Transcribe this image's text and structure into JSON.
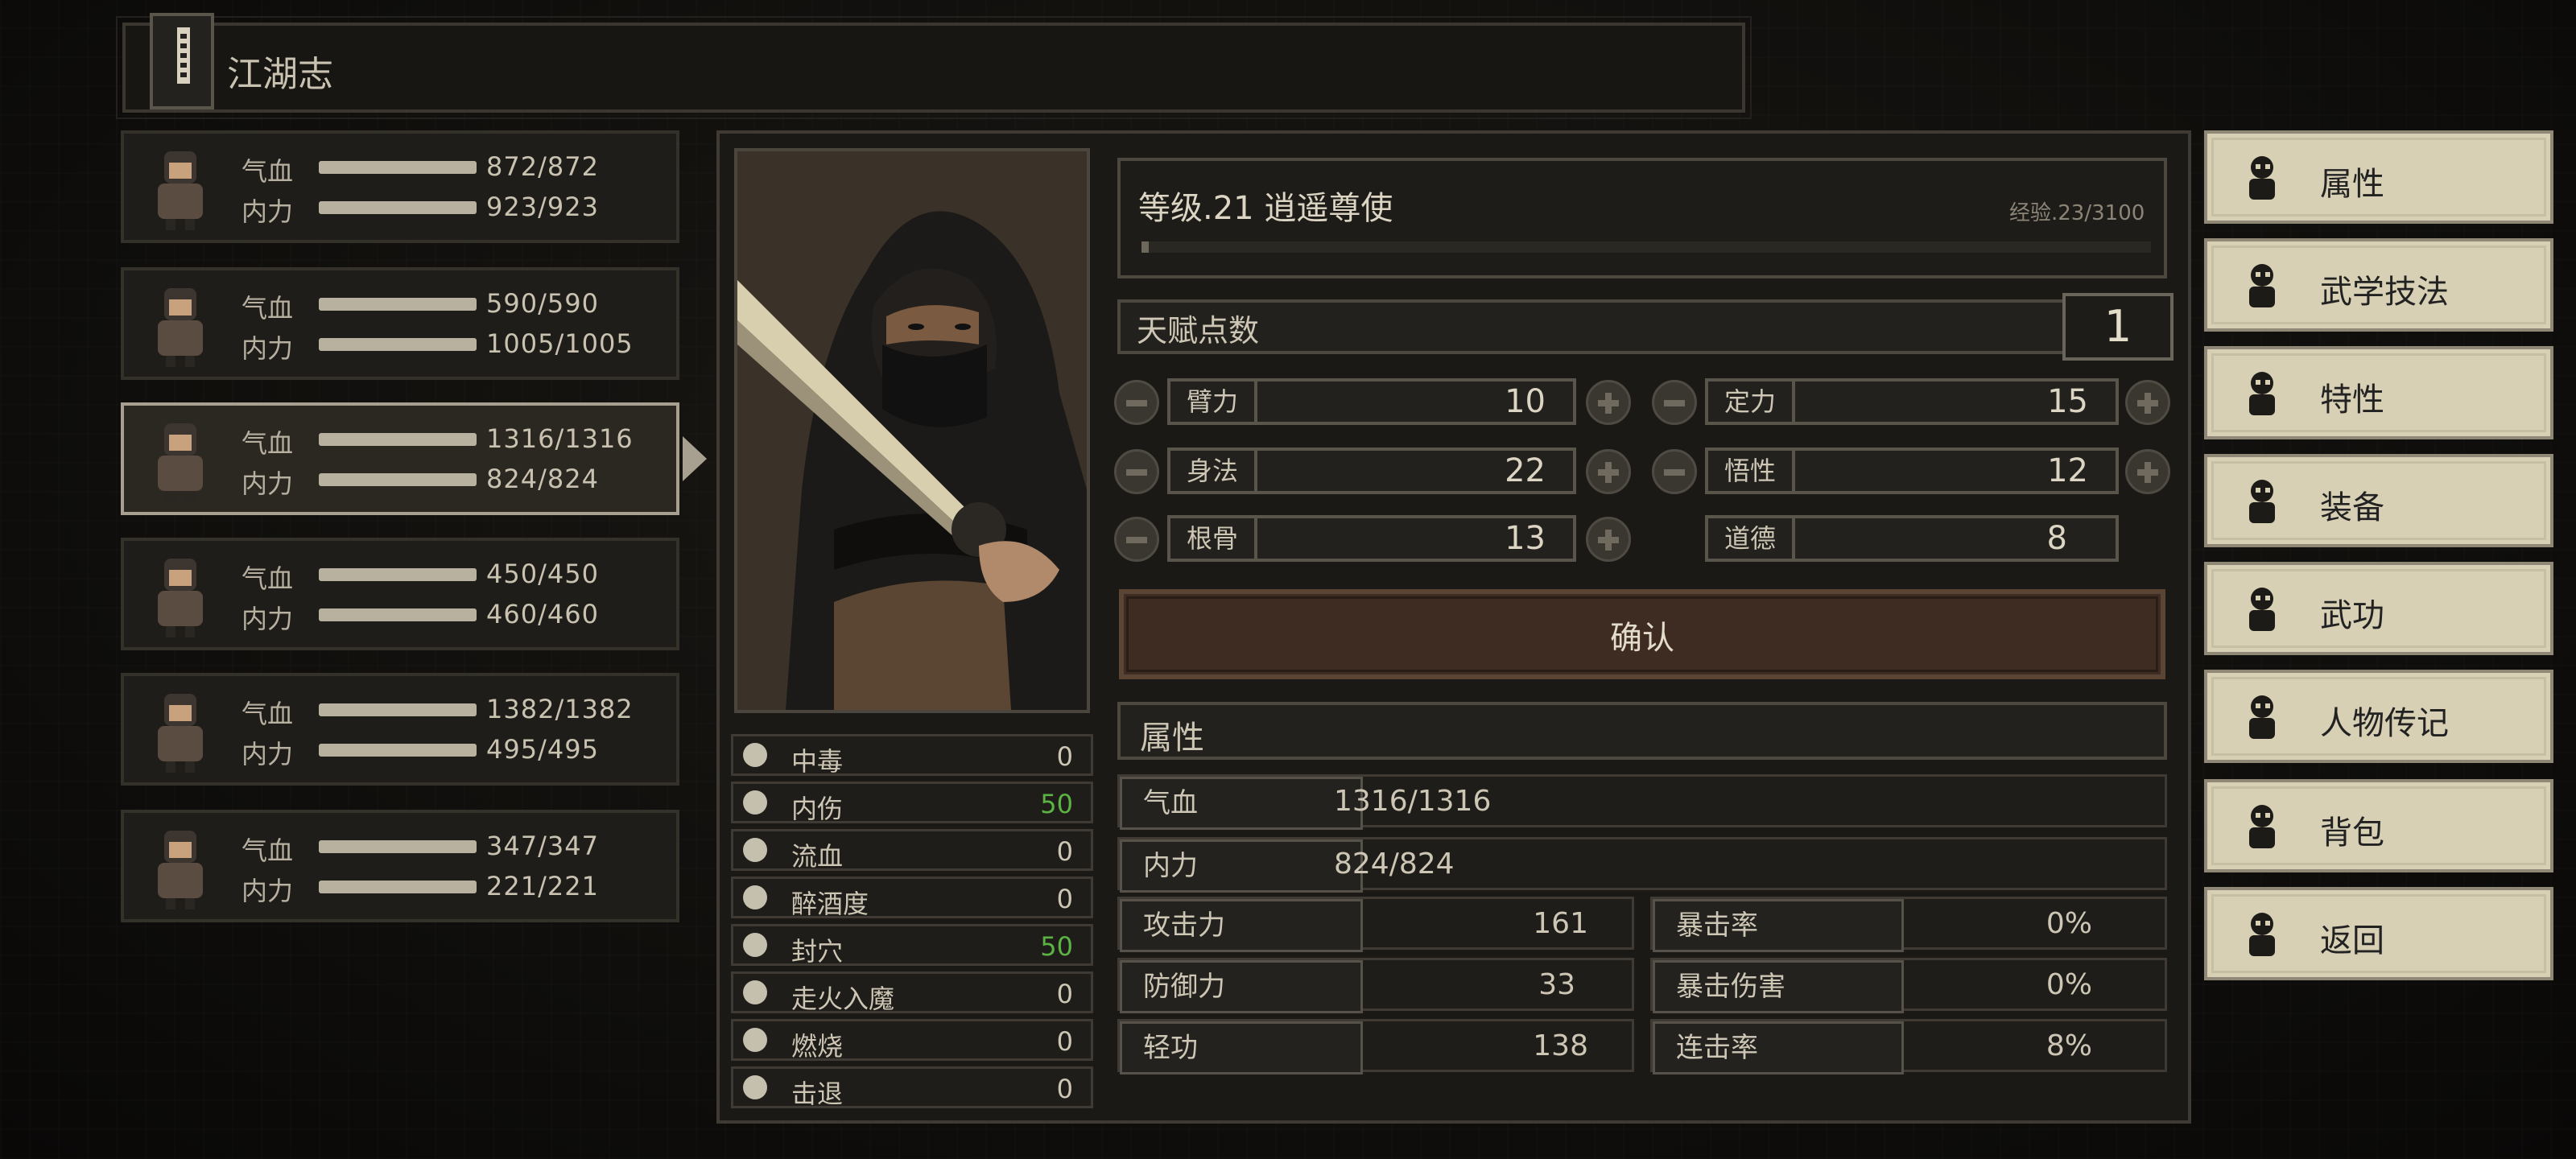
{
  "window": {
    "title": "江湖志"
  },
  "party": [
    {
      "hp_label": "气血",
      "hp": "872/872",
      "mp_label": "内力",
      "mp": "923/923",
      "avatar": "monk-icon"
    },
    {
      "hp_label": "气血",
      "hp": "590/590",
      "mp_label": "内力",
      "mp": "1005/1005",
      "avatar": "scholar-icon"
    },
    {
      "hp_label": "气血",
      "hp": "1316/1316",
      "mp_label": "内力",
      "mp": "824/824",
      "avatar": "assassin-icon"
    },
    {
      "hp_label": "气血",
      "hp": "450/450",
      "mp_label": "内力",
      "mp": "460/460",
      "avatar": "official-icon"
    },
    {
      "hp_label": "气血",
      "hp": "1382/1382",
      "mp_label": "内力",
      "mp": "495/495",
      "avatar": "straw-hat-icon"
    },
    {
      "hp_label": "气血",
      "hp": "347/347",
      "mp_label": "内力",
      "mp": "221/221",
      "avatar": "goose-icon"
    }
  ],
  "character": {
    "level_line": "等级.21  逍遥尊使",
    "exp_label": "经验.23/3100",
    "exp_fraction": 0.0074,
    "talent_label": "天赋点数",
    "talent_points": "1"
  },
  "attributes": [
    {
      "label": "臂力",
      "value": "10"
    },
    {
      "label": "定力",
      "value": "15"
    },
    {
      "label": "身法",
      "value": "22"
    },
    {
      "label": "悟性",
      "value": "12"
    },
    {
      "label": "根骨",
      "value": "13"
    },
    {
      "label": "道德",
      "value": "8"
    }
  ],
  "confirm_label": "确认",
  "properties": {
    "section_title": "属性",
    "hp": {
      "label": "气血",
      "value": "1316/1316"
    },
    "mp": {
      "label": "内力",
      "value": "824/824"
    },
    "attack": {
      "label": "攻击力",
      "value": "161"
    },
    "crit_rate": {
      "label": "暴击率",
      "value": "0%"
    },
    "defense": {
      "label": "防御力",
      "value": "33"
    },
    "crit_dmg": {
      "label": "暴击伤害",
      "value": "0%"
    },
    "agility": {
      "label": "轻功",
      "value": "138"
    },
    "combo": {
      "label": "连击率",
      "value": "8%"
    }
  },
  "statuses": [
    {
      "name": "中毒",
      "value": "0",
      "icon": "skull-icon"
    },
    {
      "name": "内伤",
      "value": "50",
      "icon": "broken-heart-icon"
    },
    {
      "name": "流血",
      "value": "0",
      "icon": "blood-icon"
    },
    {
      "name": "醉酒度",
      "value": "0",
      "icon": "drunk-icon"
    },
    {
      "name": "封穴",
      "value": "50",
      "icon": "seal-icon"
    },
    {
      "name": "走火入魔",
      "value": "0",
      "icon": "demon-icon"
    },
    {
      "name": "燃烧",
      "value": "0",
      "icon": "flame-icon"
    },
    {
      "name": "击退",
      "value": "0",
      "icon": "boot-icon"
    }
  ],
  "menu": [
    {
      "label": "属性",
      "icon": "character-icon"
    },
    {
      "label": "武学技法",
      "icon": "martial-skill-icon"
    },
    {
      "label": "特性",
      "icon": "trait-icon"
    },
    {
      "label": "装备",
      "icon": "sword-icon"
    },
    {
      "label": "武功",
      "icon": "manual-icon"
    },
    {
      "label": "人物传记",
      "icon": "scroll-icon"
    },
    {
      "label": "背包",
      "icon": "bag-icon"
    },
    {
      "label": "返回",
      "icon": "door-icon"
    }
  ],
  "colors": {
    "accent_green": "#5bb343",
    "menu_bg": "#d7d0b5",
    "confirm_bg": "#3e2c22"
  }
}
